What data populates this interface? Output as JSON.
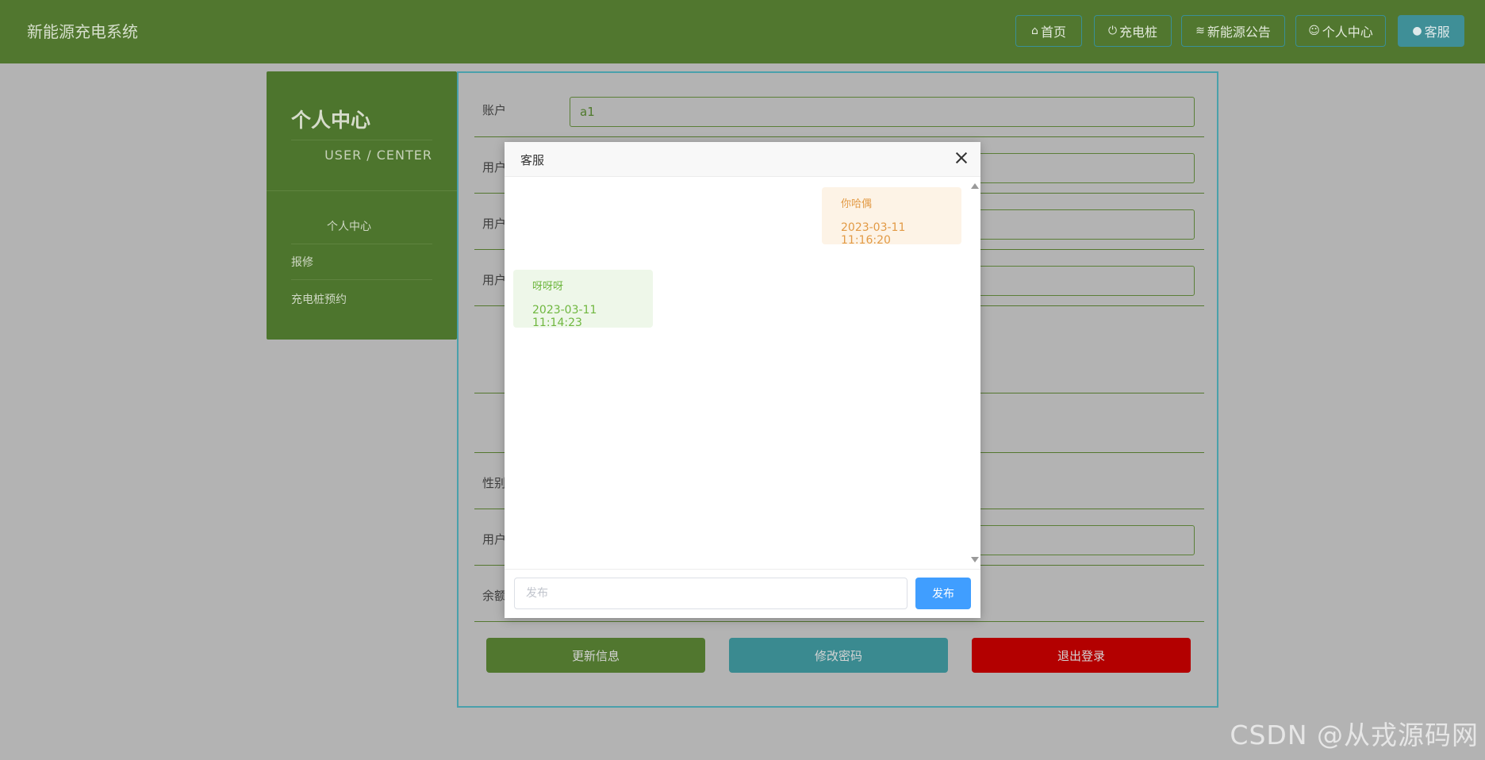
{
  "header": {
    "brand": "新能源充电系统",
    "nav": [
      {
        "icon": "home-icon",
        "label": "首页"
      },
      {
        "icon": "plug-icon",
        "label": "充电桩"
      },
      {
        "icon": "layers-icon",
        "label": "新能源公告"
      },
      {
        "icon": "user-icon",
        "label": "个人中心"
      },
      {
        "icon": "chat-icon",
        "label": "客服"
      }
    ]
  },
  "sidebar": {
    "title": "个人中心",
    "subtitle": "USER / CENTER",
    "items": [
      "个人中心",
      "报修",
      "充电桩预约"
    ]
  },
  "form": {
    "labels": {
      "account": "账户",
      "user1": "用户",
      "user2": "用户",
      "user3": "用户",
      "gender": "性别",
      "user4": "用户",
      "balance": "余额"
    },
    "account_value": "a1",
    "buttons": {
      "update": "更新信息",
      "change_password": "修改密码",
      "logout": "退出登录"
    }
  },
  "modal": {
    "title": "客服",
    "messages": [
      {
        "side": "right",
        "text": "你哈偶",
        "time": "2023-03-11 11:16:20"
      },
      {
        "side": "left",
        "text": "呀呀呀",
        "time": "2023-03-11 11:14:23"
      }
    ],
    "input_placeholder": "发布",
    "send_label": "发布"
  },
  "watermark": "CSDN @从戎源码网",
  "colors": {
    "header_bg": "#51772f",
    "right_bubble_bg": "#fdf3e6",
    "left_bubble_bg": "#eef7e9",
    "send_button": "#409eff",
    "logout_button": "#b30000"
  }
}
